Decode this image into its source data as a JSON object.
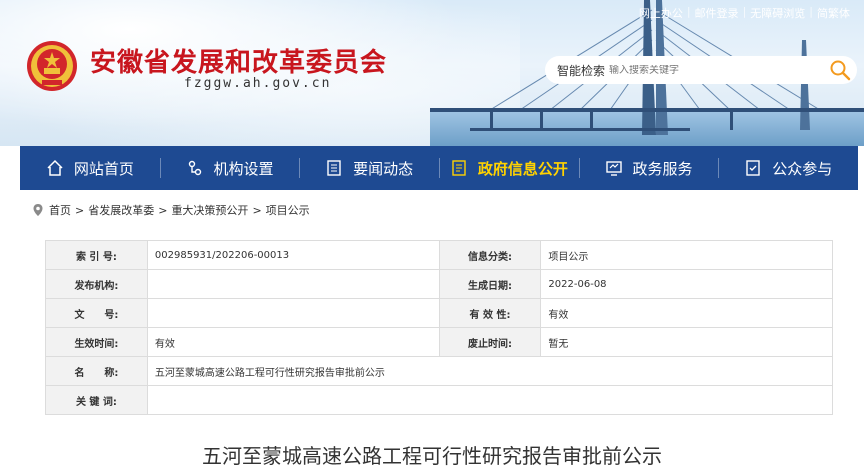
{
  "header": {
    "title": "安徽省发展和改革委员会",
    "domain": "fzggw.ah.gov.cn",
    "top_links": [
      "网上办公",
      "邮件登录",
      "无障碍浏览",
      "简繁体"
    ],
    "search": {
      "label": "智能检索",
      "placeholder": "输入搜索关键字"
    }
  },
  "nav": {
    "items": [
      {
        "label": "网站首页",
        "icon": "home-icon"
      },
      {
        "label": "机构设置",
        "icon": "org-icon"
      },
      {
        "label": "要闻动态",
        "icon": "news-icon"
      },
      {
        "label": "政府信息公开",
        "icon": "info-icon",
        "active": true
      },
      {
        "label": "政务服务",
        "icon": "service-icon"
      },
      {
        "label": "公众参与",
        "icon": "participate-icon"
      }
    ]
  },
  "breadcrumb": [
    "首页",
    "省发展改革委",
    "重大决策预公开",
    "项目公示"
  ],
  "info_table": {
    "index_label": "索 引 号:",
    "index_value": "002985931/202206-00013",
    "category_label": "信息分类:",
    "category_value": "项目公示",
    "publisher_label": "发布机构:",
    "publisher_value": "",
    "created_label": "生成日期:",
    "created_value": "2022-06-08",
    "docno_label": "文　　号:",
    "docno_value": "",
    "validity_label": "有 效 性:",
    "validity_value": "有效",
    "effective_label": "生效时间:",
    "effective_value": "有效",
    "expiry_label": "废止时间:",
    "expiry_value": "暂无",
    "name_label": "名　　称:",
    "name_value": "五河至蒙城高速公路工程可行性研究报告审批前公示",
    "keywords_label": "关 键 词:",
    "keywords_value": ""
  },
  "doc_title": "五河至蒙城高速公路工程可行性研究报告审批前公示",
  "colors": {
    "brand_red": "#c8161e",
    "nav_blue": "#1e4a92",
    "nav_active": "#ffd200"
  }
}
